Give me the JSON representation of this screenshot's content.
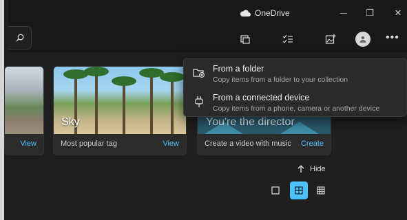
{
  "app": {
    "onedrive_label": "OneDrive"
  },
  "window_controls": {
    "minimize": "—",
    "maximize": "❐",
    "close": "✕"
  },
  "toolbar": {
    "icons": [
      "search-icon",
      "import-photos-icon",
      "select-icon",
      "add-image-icon",
      "account-icon",
      "more-icon"
    ]
  },
  "cards": [
    {
      "label": "",
      "link": "View"
    },
    {
      "overlay": "Sky",
      "caption": "Most popular tag",
      "link": "View"
    },
    {
      "overlay": "You're the director",
      "caption": "Create a video with music",
      "link": "Create"
    }
  ],
  "menu": {
    "items": [
      {
        "title": "From a folder",
        "description": "Copy items from a folder to your collection",
        "icon": "folder-add-icon"
      },
      {
        "title": "From a connected device",
        "description": "Copy items from a phone, camera or another device",
        "icon": "device-plug-icon"
      }
    ]
  },
  "hide": {
    "label": "Hide"
  },
  "view_modes": {
    "selected": "medium-grid"
  },
  "colors": {
    "accent": "#4cc2ff",
    "menu_bg": "#2a2a2a",
    "window_bg": "#1f1f1f"
  }
}
